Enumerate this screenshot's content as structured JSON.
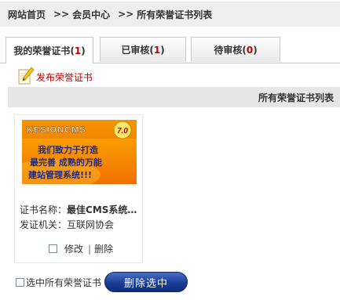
{
  "breadcrumb": {
    "home": "网站首页",
    "separator": ">>",
    "member": "会员中心",
    "current": "所有荣誉证书列表"
  },
  "tabs": [
    {
      "label": "我的荣誉证书",
      "count": "1",
      "active": true
    },
    {
      "label": "已审核",
      "count": "1",
      "active": false
    },
    {
      "label": "待审核",
      "count": "0",
      "active": false
    }
  ],
  "publish": {
    "label": "发布荣誉证书",
    "icon": "pencil-paper-icon"
  },
  "section": {
    "title": "所有荣誉证书列表"
  },
  "certificate": {
    "image_text": {
      "brand": "KESIONCMS",
      "version": "7.0",
      "line1": "我们致力于打造",
      "line2": "最完善 成熟的万能",
      "line3": "建站管理系统!!!"
    },
    "name_label": "证书名称：",
    "name_value": "最佳CMS系统…",
    "issuer_label": "发证机关：",
    "issuer_value": "互联网协会",
    "edit_label": "修改",
    "separator": "|",
    "delete_label": "删除"
  },
  "footer": {
    "select_all_label": "选中所有荣誉证书",
    "delete_selected_label": "删除选中"
  },
  "colors": {
    "count_red": "#c00000",
    "publish_red": "#c00000",
    "button_blue": "#1a3d96",
    "header_gray": "#e6e6e6"
  }
}
